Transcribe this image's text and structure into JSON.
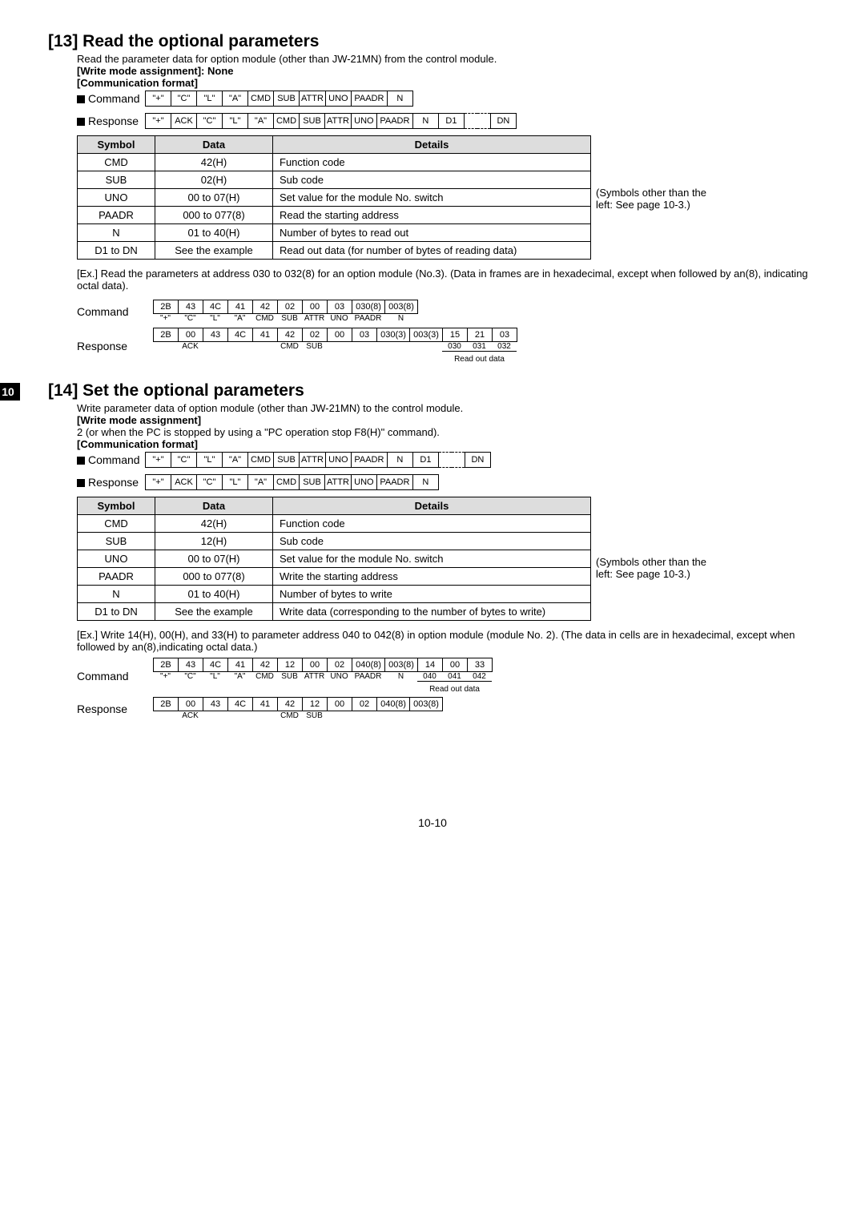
{
  "s13": {
    "heading": "[13] Read the optional parameters",
    "desc": "Read the parameter data for option module (other than JW-21MN) from the control module.",
    "writeMode": "[Write mode assignment]: None",
    "commFmt": "[Communication format]",
    "commandLabel": "Command",
    "responseLabel": "Response",
    "cmdCells": [
      "\"+\"",
      "\"C\"",
      "\"L\"",
      "\"A\"",
      "CMD",
      "SUB",
      "ATTR",
      "UNO",
      "PAADR",
      "N"
    ],
    "respCells": [
      "\"+\"",
      "ACK",
      "\"C\"",
      "\"L\"",
      "\"A\"",
      "CMD",
      "SUB",
      "ATTR",
      "UNO",
      "PAADR",
      "N",
      "D1",
      "",
      "DN"
    ],
    "table": {
      "h1": "Symbol",
      "h2": "Data",
      "h3": "Details",
      "rows": [
        [
          "CMD",
          "42(H)",
          "Function code"
        ],
        [
          "SUB",
          "02(H)",
          "Sub code"
        ],
        [
          "UNO",
          "00 to 07(H)",
          "Set value for the module No. switch"
        ],
        [
          "PAADR",
          "000 to 077(8)",
          "Read the starting address"
        ],
        [
          "N",
          "01 to 40(H)",
          "Number of bytes to read out"
        ],
        [
          "D1 to DN",
          "See the example",
          "Read out data (for number of bytes of reading data)"
        ]
      ]
    },
    "sideNote": "(Symbols other than the left: See page 10-3.)",
    "ex": "[Ex.] Read the parameters at address 030 to 032(8) for an option module (No.3). (Data in frames are in hexadecimal, except when followed by an(8), indicating octal data).",
    "exCmdLabel": "Command",
    "exCmdCells": [
      "2B",
      "43",
      "4C",
      "41",
      "42",
      "02",
      "00",
      "03",
      "030(8)",
      "003(8)"
    ],
    "exCmdSubs": [
      "\"+\"",
      "\"C\"",
      "\"L\"",
      "\"A\"",
      "CMD",
      "SUB",
      "ATTR",
      "UNO",
      "PAADR",
      "N"
    ],
    "exRespLabel": "Response",
    "exRespCells": [
      "2B",
      "00",
      "43",
      "4C",
      "41",
      "42",
      "02",
      "00",
      "03",
      "030(3)",
      "003(3)",
      "15",
      "21",
      "03"
    ],
    "exRespSubs": [
      "",
      "ACK",
      "",
      "",
      "",
      "CMD",
      "SUB",
      "",
      "",
      "",
      "",
      "030",
      "031",
      "032"
    ],
    "readoutLabel": "Read out data"
  },
  "s14": {
    "heading": "[14] Set the optional parameters",
    "desc": "Write parameter data of option module (other than JW-21MN) to the control module.",
    "writeModeTitle": "[Write mode assignment]",
    "writeMode2": "2 (or when the PC is stopped by using a \"PC operation stop F8(H)\" command).",
    "commFmt": "[Communication format]",
    "commandLabel": "Command",
    "responseLabel": "Response",
    "cmdCells": [
      "\"+\"",
      "\"C\"",
      "\"L\"",
      "\"A\"",
      "CMD",
      "SUB",
      "ATTR",
      "UNO",
      "PAADR",
      "N",
      "D1",
      "",
      "DN"
    ],
    "respCells": [
      "\"+\"",
      "ACK",
      "\"C\"",
      "\"L\"",
      "\"A\"",
      "CMD",
      "SUB",
      "ATTR",
      "UNO",
      "PAADR",
      "N"
    ],
    "table": {
      "h1": "Symbol",
      "h2": "Data",
      "h3": "Details",
      "rows": [
        [
          "CMD",
          "42(H)",
          "Function code"
        ],
        [
          "SUB",
          "12(H)",
          "Sub code"
        ],
        [
          "UNO",
          "00 to 07(H)",
          "Set value for the module No. switch"
        ],
        [
          "PAADR",
          "000 to 077(8)",
          "Write the starting address"
        ],
        [
          "N",
          "01 to 40(H)",
          "Number of bytes to write"
        ],
        [
          "D1 to DN",
          "See the example",
          "Write data (corresponding to the number of bytes to write)"
        ]
      ]
    },
    "sideNote": "(Symbols other than the left: See page 10-3.)",
    "ex": "[Ex.] Write 14(H), 00(H), and 33(H) to parameter address 040 to 042(8) in option module (module No. 2). (The data in cells are in hexadecimal, except when followed by an(8),indicating octal data.)",
    "exCmdLabel": "Command",
    "exCmdCells": [
      "2B",
      "43",
      "4C",
      "41",
      "42",
      "12",
      "00",
      "02",
      "040(8)",
      "003(8)",
      "14",
      "00",
      "33"
    ],
    "exCmdSubs": [
      "\"+\"",
      "\"C\"",
      "\"L\"",
      "\"A\"",
      "CMD",
      "SUB",
      "ATTR",
      "UNO",
      "PAADR",
      "N",
      "040",
      "041",
      "042"
    ],
    "readoutLabel": "Read out data",
    "exRespLabel": "Response",
    "exRespCells": [
      "2B",
      "00",
      "43",
      "4C",
      "41",
      "42",
      "12",
      "00",
      "02",
      "040(8)",
      "003(8)"
    ],
    "exRespSubs": [
      "",
      "ACK",
      "",
      "",
      "",
      "CMD",
      "SUB",
      "",
      "",
      "",
      ""
    ]
  },
  "pageBadge": "10",
  "footer": "10-10"
}
